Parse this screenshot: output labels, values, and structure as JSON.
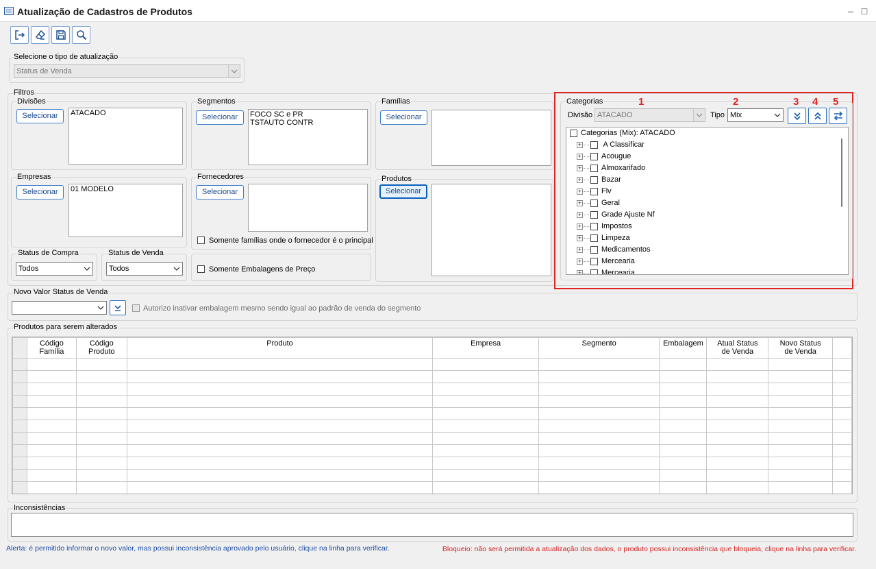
{
  "window": {
    "title": "Atualização de Cadastros de Produtos",
    "minimize": "–",
    "maximize": "□"
  },
  "toolbar": {
    "buttons": [
      {
        "icon": "exit-icon"
      },
      {
        "icon": "eraser-icon"
      },
      {
        "icon": "save-icon"
      },
      {
        "icon": "search-icon"
      }
    ]
  },
  "update_type": {
    "label": "Selecione o tipo de atualização",
    "value": "Status de Venda"
  },
  "filters": {
    "label": "Filtros",
    "select_label": "Selecionar",
    "divisoes": {
      "label": "Divisões",
      "items": [
        "ATACADO"
      ]
    },
    "segmentos": {
      "label": "Segmentos",
      "items": [
        "FOCO SC e PR",
        "TSTAUTO CONTR"
      ]
    },
    "familias": {
      "label": "Famílias",
      "items": []
    },
    "empresas": {
      "label": "Empresas",
      "items": [
        "01 MODELO"
      ]
    },
    "fornecedores": {
      "label": "Fornecedores",
      "items": []
    },
    "produtos": {
      "label": "Produtos",
      "items": []
    },
    "only_principal": "Somente famílias onde o fornecedor é o principal",
    "only_price_packages": "Somente Embalagens de Preço",
    "status_compra": {
      "label": "Status de Compra",
      "value": "Todos"
    },
    "status_venda": {
      "label": "Status de Venda",
      "value": "Todos"
    }
  },
  "categorias": {
    "label": "Categorias",
    "divisao_label": "Divisão",
    "divisao_value": "ATACADO",
    "tipo_label": "Tipo",
    "tipo_value": "Mix",
    "markers": [
      "1",
      "2",
      "3",
      "4",
      "5"
    ],
    "action_icons": [
      "expand-all-icon",
      "collapse-all-icon",
      "swap-icon"
    ],
    "highlight_color": "#e02424",
    "root": "Categorias (Mix): ATACADO",
    "items": [
      " A Classificar",
      "Acougue",
      "Almoxarifado",
      "Bazar",
      "Flv",
      "Geral",
      "Grade Ajuste Nf",
      "Impostos",
      "Limpeza",
      "Medicamentos",
      "Mercearia",
      "Mercearia"
    ]
  },
  "novo_valor": {
    "label": "Novo Valor Status de Venda",
    "value": "",
    "authorize": "Autorizo inativar embalagem mesmo sendo igual ao padrão de venda do segmento"
  },
  "products_grid": {
    "label": "Produtos para serem alterados",
    "columns": [
      [
        "Código",
        "Família"
      ],
      [
        "Código",
        "Produto"
      ],
      [
        "Produto"
      ],
      [
        "Empresa"
      ],
      [
        "Segmento"
      ],
      [
        "Embalagem"
      ],
      [
        "Atual Status",
        "de Venda"
      ],
      [
        "Novo Status",
        "de Venda"
      ]
    ]
  },
  "inconsistencias": {
    "label": "Inconsistências"
  },
  "footer": {
    "alert": "Alerta: é permitido informar o novo valor, mas possui inconsistência aprovado pelo usuário, clique na linha para verificar.",
    "block": "Bloqueio: não será permitida a atualização dos dados, o produto possui inconsistência que bloqueia, clique na linha para verificar.",
    "alert_color": "#1f4fa8",
    "block_color": "#d41f1f"
  }
}
